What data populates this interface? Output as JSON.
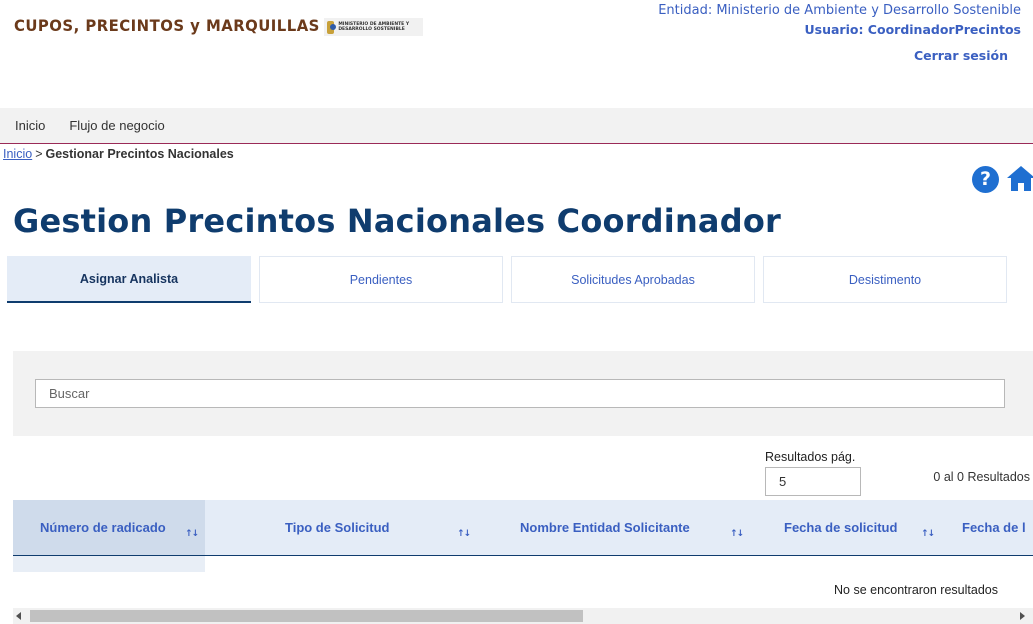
{
  "header": {
    "logo_text": "CUPOS, PRECINTOS y MARQUILLAS",
    "ministry_logo_text": "MINISTERIO DE AMBIENTE Y DESARROLLO SOSTENIBLE",
    "entity": "Entidad: Ministerio de Ambiente y Desarrollo Sostenible",
    "user": "Usuario: CoordinadorPrecintos",
    "logout": "Cerrar sesión"
  },
  "nav": {
    "items": [
      {
        "label": "Inicio"
      },
      {
        "label": "Flujo de negocio"
      }
    ]
  },
  "breadcrumb": {
    "home": "Inicio",
    "separator": ">",
    "current": "Gestionar Precintos Nacionales"
  },
  "icons": {
    "help": "help-circle-icon",
    "home": "home-icon"
  },
  "page_title": "Gestion Precintos Nacionales Coordinador",
  "tabs": [
    {
      "label": "Asignar Analista",
      "active": true
    },
    {
      "label": "Pendientes",
      "active": false
    },
    {
      "label": "Solicitudes Aprobadas",
      "active": false
    },
    {
      "label": "Desistimento",
      "active": false
    }
  ],
  "search": {
    "placeholder": "Buscar",
    "value": ""
  },
  "pagination": {
    "page_size_label": "Resultados pág.",
    "page_size_value": "5",
    "results_text": "0 al 0 Resultados"
  },
  "table": {
    "columns": [
      {
        "label": "Número de radicado",
        "sort": "↑↓"
      },
      {
        "label": "Tipo de Solicitud",
        "sort": "↑↓"
      },
      {
        "label": "Nombre Entidad Solicitante",
        "sort": "↑↓"
      },
      {
        "label": "Fecha de solicitud",
        "sort": "↑↓"
      },
      {
        "label": "Fecha de l",
        "sort": ""
      }
    ],
    "empty_text": "No se encontraron resultados"
  },
  "colors": {
    "primary_blue": "#3a5fc1",
    "title_navy": "#0f3c6e",
    "tab_active_bg": "#e4ecf7",
    "nav_border": "#9a2a57",
    "help_blue": "#1f6fd1"
  }
}
